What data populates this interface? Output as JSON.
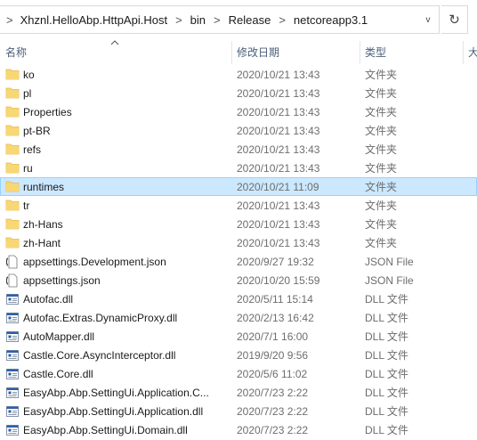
{
  "address": {
    "crumbs": [
      "Xhznl.HelloAbp.HttpApi.Host",
      "bin",
      "Release",
      "netcoreapp3.1"
    ],
    "separator": ">",
    "dropdown_glyph": "v",
    "refresh_glyph": "↻"
  },
  "columns": {
    "name": "名称",
    "date": "修改日期",
    "type": "类型",
    "size": "大"
  },
  "selected_row": 6,
  "rows": [
    {
      "name": "ko",
      "date": "2020/10/21 13:43",
      "type": "文件夹",
      "icon": "folder-icon"
    },
    {
      "name": "pl",
      "date": "2020/10/21 13:43",
      "type": "文件夹",
      "icon": "folder-icon"
    },
    {
      "name": "Properties",
      "date": "2020/10/21 13:43",
      "type": "文件夹",
      "icon": "folder-icon"
    },
    {
      "name": "pt-BR",
      "date": "2020/10/21 13:43",
      "type": "文件夹",
      "icon": "folder-icon"
    },
    {
      "name": "refs",
      "date": "2020/10/21 13:43",
      "type": "文件夹",
      "icon": "folder-icon"
    },
    {
      "name": "ru",
      "date": "2020/10/21 13:43",
      "type": "文件夹",
      "icon": "folder-icon"
    },
    {
      "name": "runtimes",
      "date": "2020/10/21 11:09",
      "type": "文件夹",
      "icon": "folder-icon"
    },
    {
      "name": "tr",
      "date": "2020/10/21 13:43",
      "type": "文件夹",
      "icon": "folder-icon"
    },
    {
      "name": "zh-Hans",
      "date": "2020/10/21 13:43",
      "type": "文件夹",
      "icon": "folder-icon"
    },
    {
      "name": "zh-Hant",
      "date": "2020/10/21 13:43",
      "type": "文件夹",
      "icon": "folder-icon"
    },
    {
      "name": "appsettings.Development.json",
      "date": "2020/9/27 19:32",
      "type": "JSON File",
      "icon": "json-file-icon"
    },
    {
      "name": "appsettings.json",
      "date": "2020/10/20 15:59",
      "type": "JSON File",
      "icon": "json-file-icon"
    },
    {
      "name": "Autofac.dll",
      "date": "2020/5/11 15:14",
      "type": "DLL 文件",
      "icon": "dll-file-icon"
    },
    {
      "name": "Autofac.Extras.DynamicProxy.dll",
      "date": "2020/2/13 16:42",
      "type": "DLL 文件",
      "icon": "dll-file-icon"
    },
    {
      "name": "AutoMapper.dll",
      "date": "2020/7/1 16:00",
      "type": "DLL 文件",
      "icon": "dll-file-icon"
    },
    {
      "name": "Castle.Core.AsyncInterceptor.dll",
      "date": "2019/9/20 9:56",
      "type": "DLL 文件",
      "icon": "dll-file-icon"
    },
    {
      "name": "Castle.Core.dll",
      "date": "2020/5/6 11:02",
      "type": "DLL 文件",
      "icon": "dll-file-icon"
    },
    {
      "name": "EasyAbp.Abp.SettingUi.Application.C...",
      "date": "2020/7/23 2:22",
      "type": "DLL 文件",
      "icon": "dll-file-icon"
    },
    {
      "name": "EasyAbp.Abp.SettingUi.Application.dll",
      "date": "2020/7/23 2:22",
      "type": "DLL 文件",
      "icon": "dll-file-icon"
    },
    {
      "name": "EasyAbp.Abp.SettingUi.Domain.dll",
      "date": "2020/7/23 2:22",
      "type": "DLL 文件",
      "icon": "dll-file-icon"
    }
  ],
  "colors": {
    "folder": "#f8d775",
    "folder_dark": "#e6b94a",
    "selection": "#cce8ff",
    "selection_border": "#99d1ff",
    "header_text": "#4c607a",
    "secondary_text": "#6d6d6d",
    "dll_blue": "#2f5fa8"
  }
}
